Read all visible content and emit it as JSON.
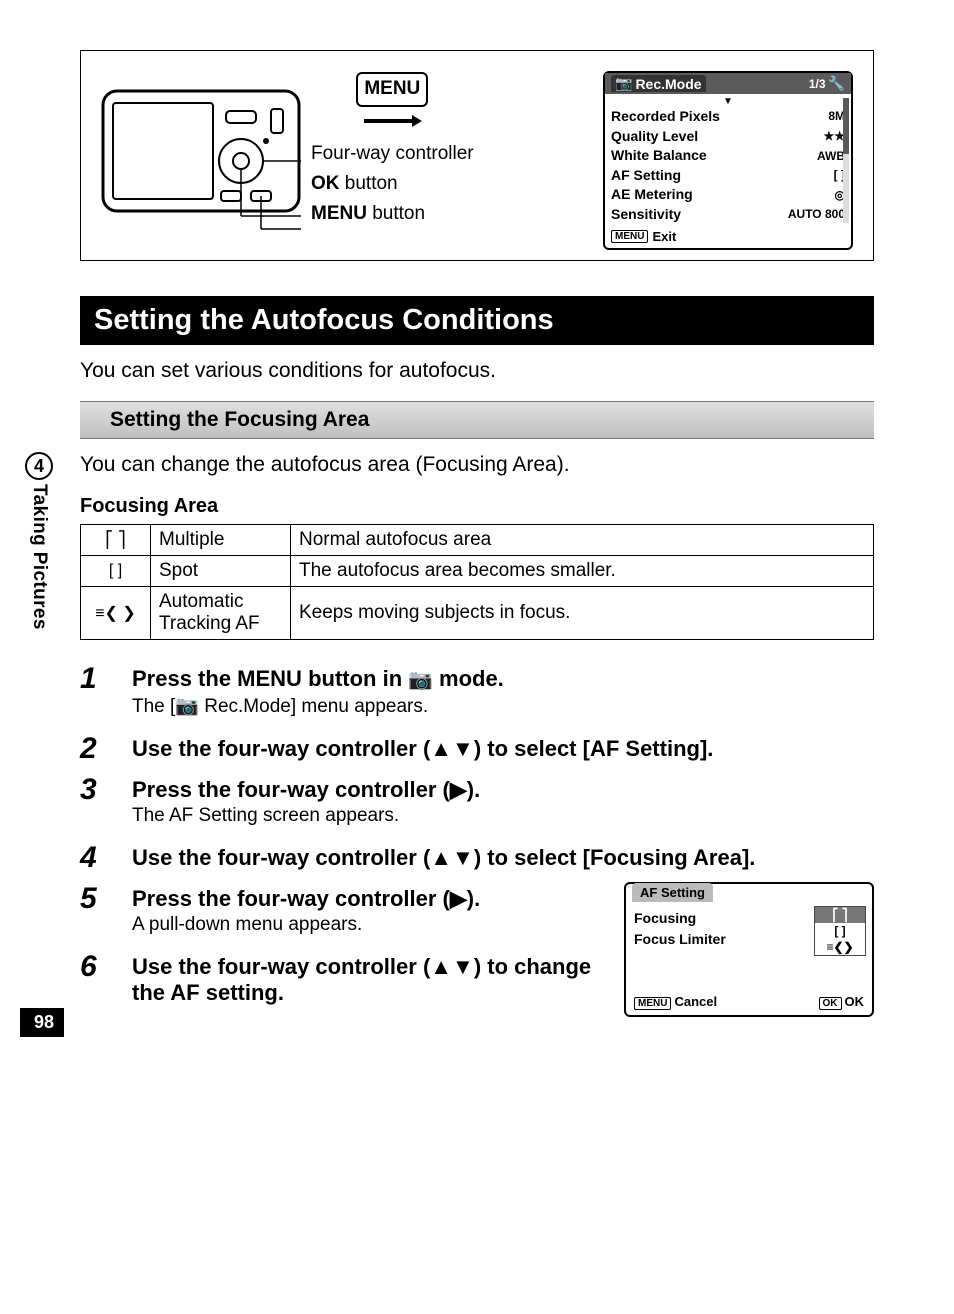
{
  "side": {
    "chapter": "4",
    "label": "Taking Pictures",
    "page": "98"
  },
  "diagram": {
    "menu_badge": "MENU",
    "fourway": "Four-way controller",
    "ok_bold": "OK",
    "ok_rest": " button",
    "menu_bold": "MENU",
    "menu_rest": " button"
  },
  "recmode": {
    "title": "Rec.Mode",
    "page": "1/3",
    "rows": [
      {
        "label": "Recorded Pixels",
        "value": "8M"
      },
      {
        "label": "Quality Level",
        "value": "★★"
      },
      {
        "label": "White Balance",
        "value": "AWB"
      },
      {
        "label": "AF Setting",
        "value": "[ ]"
      },
      {
        "label": "AE Metering",
        "value": "◎"
      },
      {
        "label": "Sensitivity",
        "value": "AUTO 800"
      }
    ],
    "footer_badge": "MENU",
    "footer_label": "Exit"
  },
  "h1": "Setting the Autofocus Conditions",
  "intro": "You can set various conditions for autofocus.",
  "h2": "Setting the Focusing Area",
  "sub_intro": "You can change the autofocus area (Focusing Area).",
  "table_title": "Focusing Area",
  "table": [
    {
      "icon": "⎡   ⎤",
      "name": "Multiple",
      "desc": "Normal autofocus area"
    },
    {
      "icon": "[ ]",
      "name": "Spot",
      "desc": "The autofocus area becomes smaller."
    },
    {
      "icon": "≡❮ ❯",
      "name": "Automatic Tracking AF",
      "desc": "Keeps moving subjects in focus."
    }
  ],
  "steps": [
    {
      "n": "1",
      "title_pre": "Press the ",
      "title_mid": "MENU",
      "title_post": " button in ",
      "title_end": " mode.",
      "camera_icon": true,
      "desc": "The [📷 Rec.Mode] menu appears."
    },
    {
      "n": "2",
      "title": "Use the four-way controller (▲▼) to select [AF Setting].",
      "desc": ""
    },
    {
      "n": "3",
      "title": "Press the four-way controller (▶).",
      "desc": "The AF Setting screen appears."
    },
    {
      "n": "4",
      "title": "Use the four-way controller (▲▼) to select [Focusing Area].",
      "desc": ""
    },
    {
      "n": "5",
      "title": "Press the four-way controller (▶).",
      "desc": "A pull-down menu appears."
    },
    {
      "n": "6",
      "title": "Use the four-way controller (▲▼) to change the AF setting.",
      "desc": ""
    }
  ],
  "afscreen": {
    "tab": "AF Setting",
    "rows": [
      {
        "label": "Focusing",
        "value": ""
      },
      {
        "label": "Focus Limiter",
        "value": ""
      }
    ],
    "dropdown": [
      "⎡  ⎤",
      "[ ]",
      "≡❮❯"
    ],
    "footer_left_badge": "MENU",
    "footer_left": "Cancel",
    "footer_right_badge": "OK",
    "footer_right": "OK"
  }
}
